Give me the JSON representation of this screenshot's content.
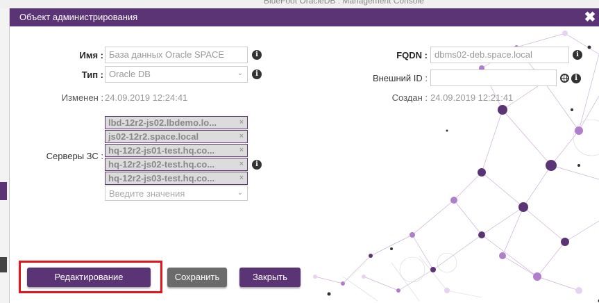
{
  "background": {
    "header_text": "BlueFoot OracleDB : Management Console"
  },
  "dialog": {
    "title": "Объект администрирования",
    "close_symbol": "✖"
  },
  "form": {
    "name": {
      "label": "Имя :",
      "value": "База данных Oracle SPACE"
    },
    "type": {
      "label": "Тип :",
      "value": "Oracle DB"
    },
    "modified": {
      "label": "Изменен :",
      "value": "24.09.2019 12:24:41"
    },
    "fqdn": {
      "label": "FQDN :",
      "value": "dbms02-deb.space.local"
    },
    "external_id": {
      "label": "Внешний ID :",
      "value": ""
    },
    "created": {
      "label": "Создан :",
      "value": "24.09.2019 12:21:41"
    },
    "servers": {
      "label": "Серверы ЗС :",
      "items": [
        "lbd-12r2-js02.lbdemo.lo...",
        "js02-12r2.space.local",
        "hq-12r2-js01-test.hq.co...",
        "hq-12r2-js02-test.hq.co...",
        "hq-12r2-js03-test.hq.co..."
      ],
      "remove_symbol": "×",
      "placeholder": "Введите значения"
    }
  },
  "buttons": {
    "edit": "Редактирование",
    "save": "Сохранить",
    "close": "Закрыть"
  },
  "colors": {
    "brand": "#5b3476",
    "highlight": "#e8141b",
    "neutral_button": "#6b6b6b"
  }
}
